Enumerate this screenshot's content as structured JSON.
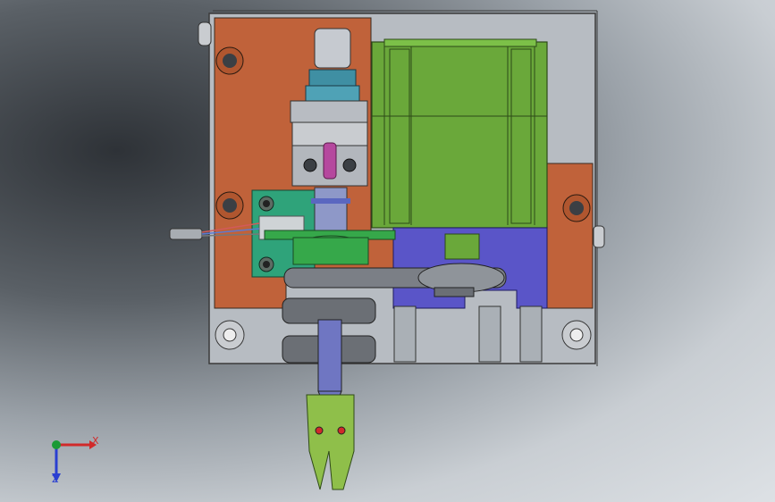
{
  "viewport": {
    "background": "#c9ced3",
    "shadow_color": "#2e3237"
  },
  "colors": {
    "plate": "#c0623a",
    "housing_outline": "#3a3a3a",
    "motor": "#6aa83a",
    "bracket_blue": "#5a55c8",
    "pcb": "#2fa37a",
    "steel": "#9aa0a8",
    "nozzle_blue": "#6f76c2",
    "gripper": "#8fbf4a",
    "cyan": "#3f8fa3",
    "magenta": "#b5489e",
    "green_pulley": "#36a84a"
  },
  "triad": {
    "x_label": "X",
    "y_label": "Y",
    "z_label": "Z",
    "x_color": "#d12a2a",
    "y_color": "#1b9a35",
    "z_color": "#2a3fd1"
  }
}
